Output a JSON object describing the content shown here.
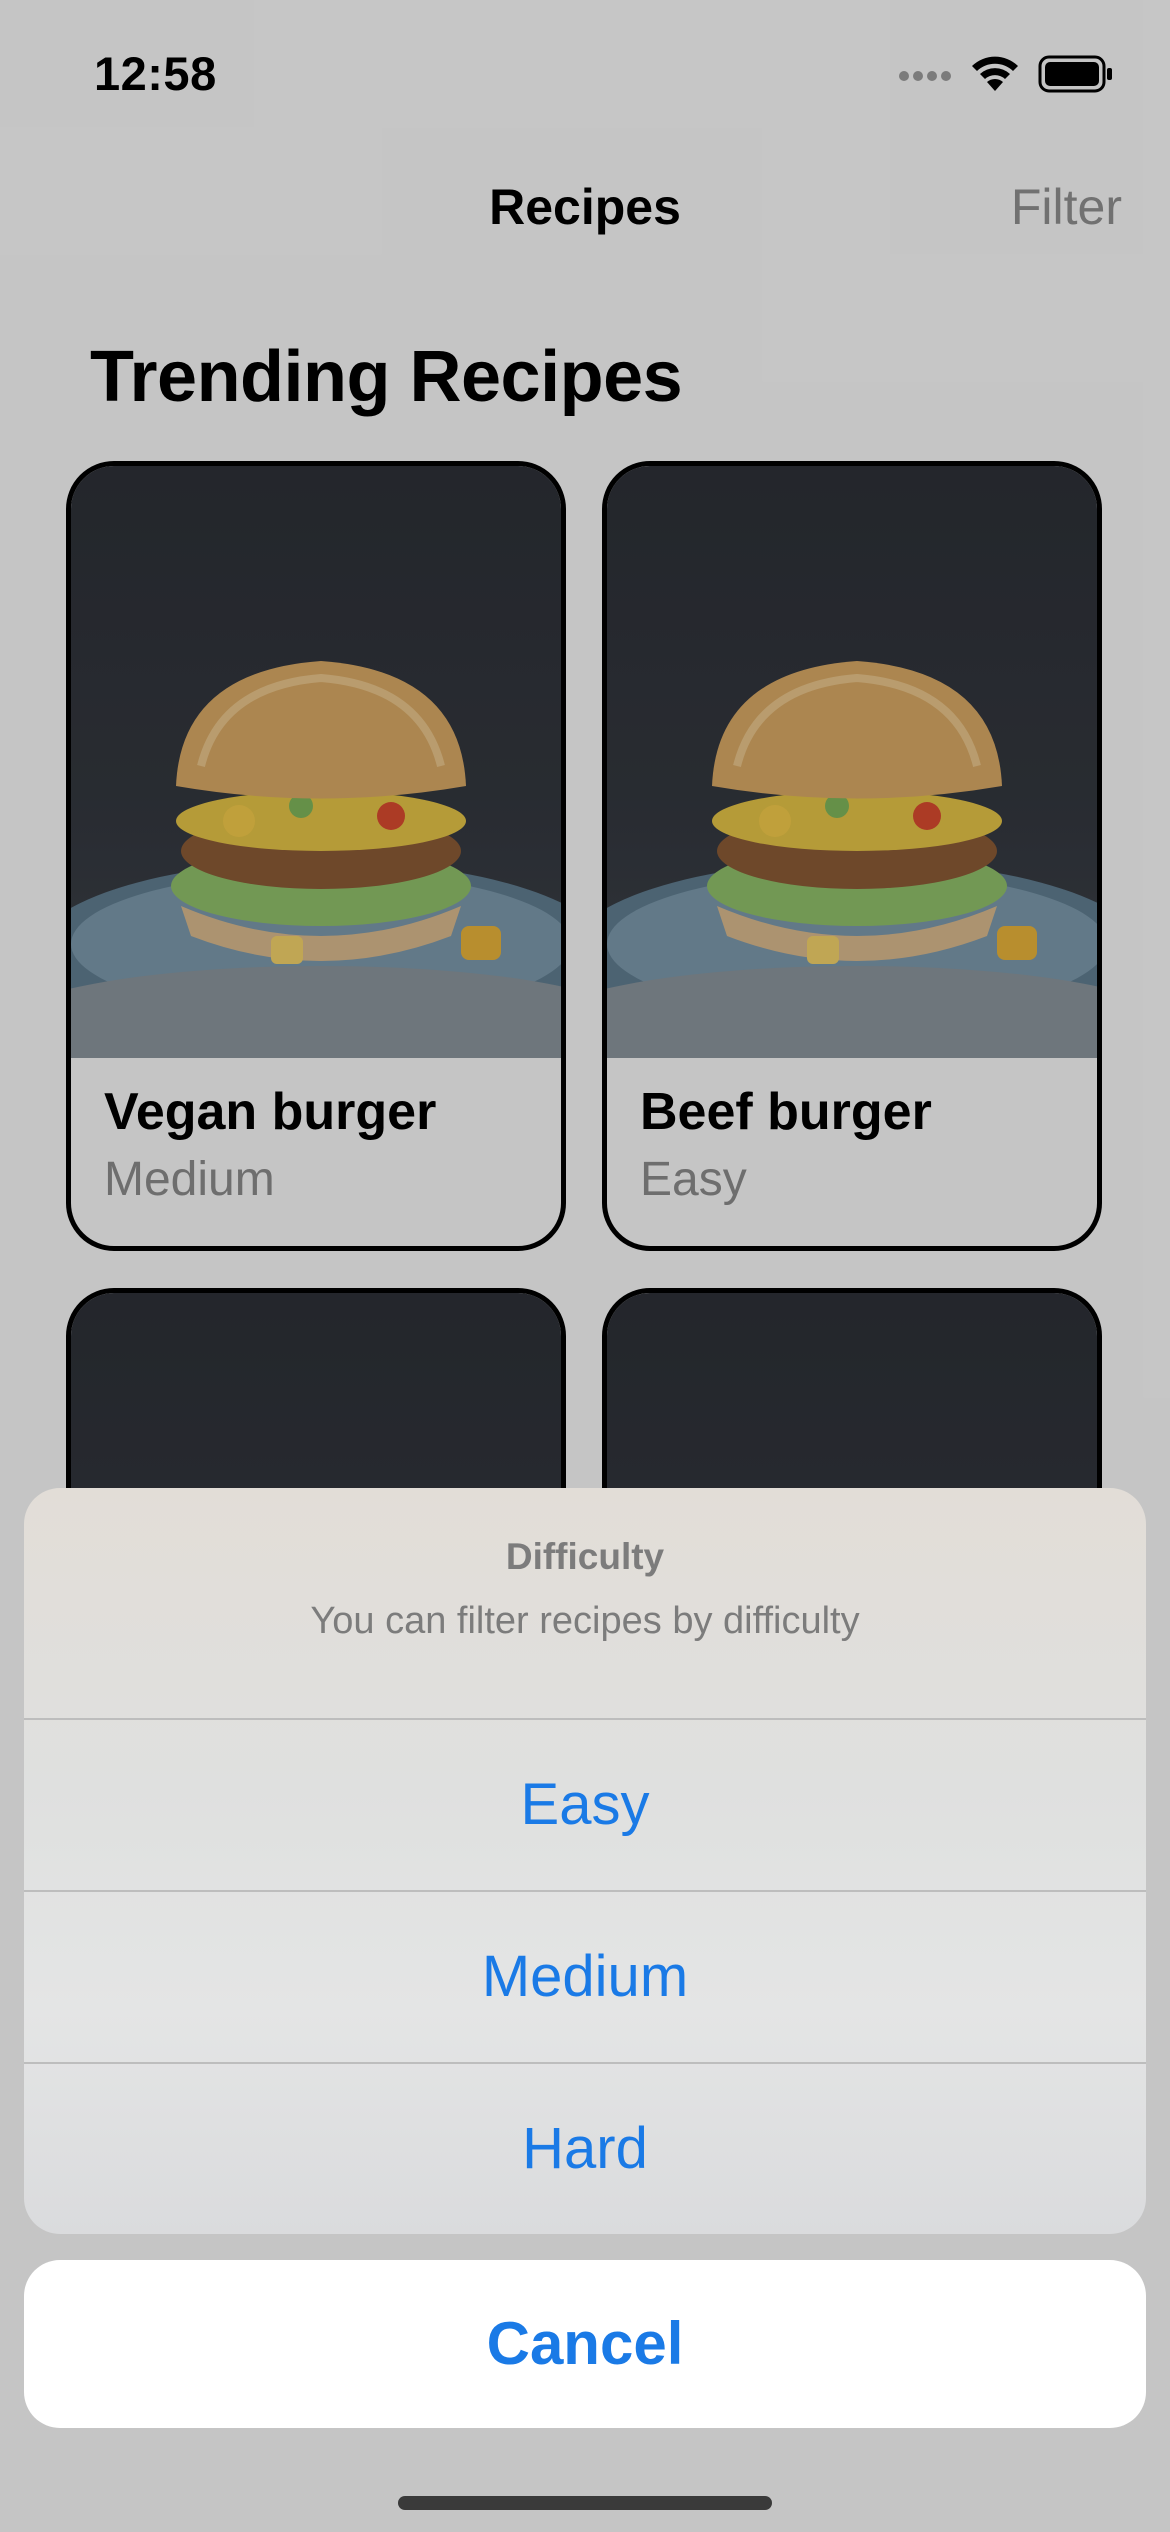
{
  "status_bar": {
    "time": "12:58"
  },
  "nav": {
    "title": "Recipes",
    "filter_label": "Filter"
  },
  "section": {
    "title": "Trending Recipes"
  },
  "recipes": [
    {
      "name": "Vegan burger",
      "difficulty": "Medium"
    },
    {
      "name": "Beef burger",
      "difficulty": "Easy"
    }
  ],
  "action_sheet": {
    "title": "Difficulty",
    "message": "You can filter recipes by difficulty",
    "options": [
      "Easy",
      "Medium",
      "Hard"
    ],
    "cancel_label": "Cancel"
  },
  "colors": {
    "accent": "#1a7ae6",
    "secondary_text": "#8a8a8a",
    "filter_text": "#8e8e8e"
  }
}
